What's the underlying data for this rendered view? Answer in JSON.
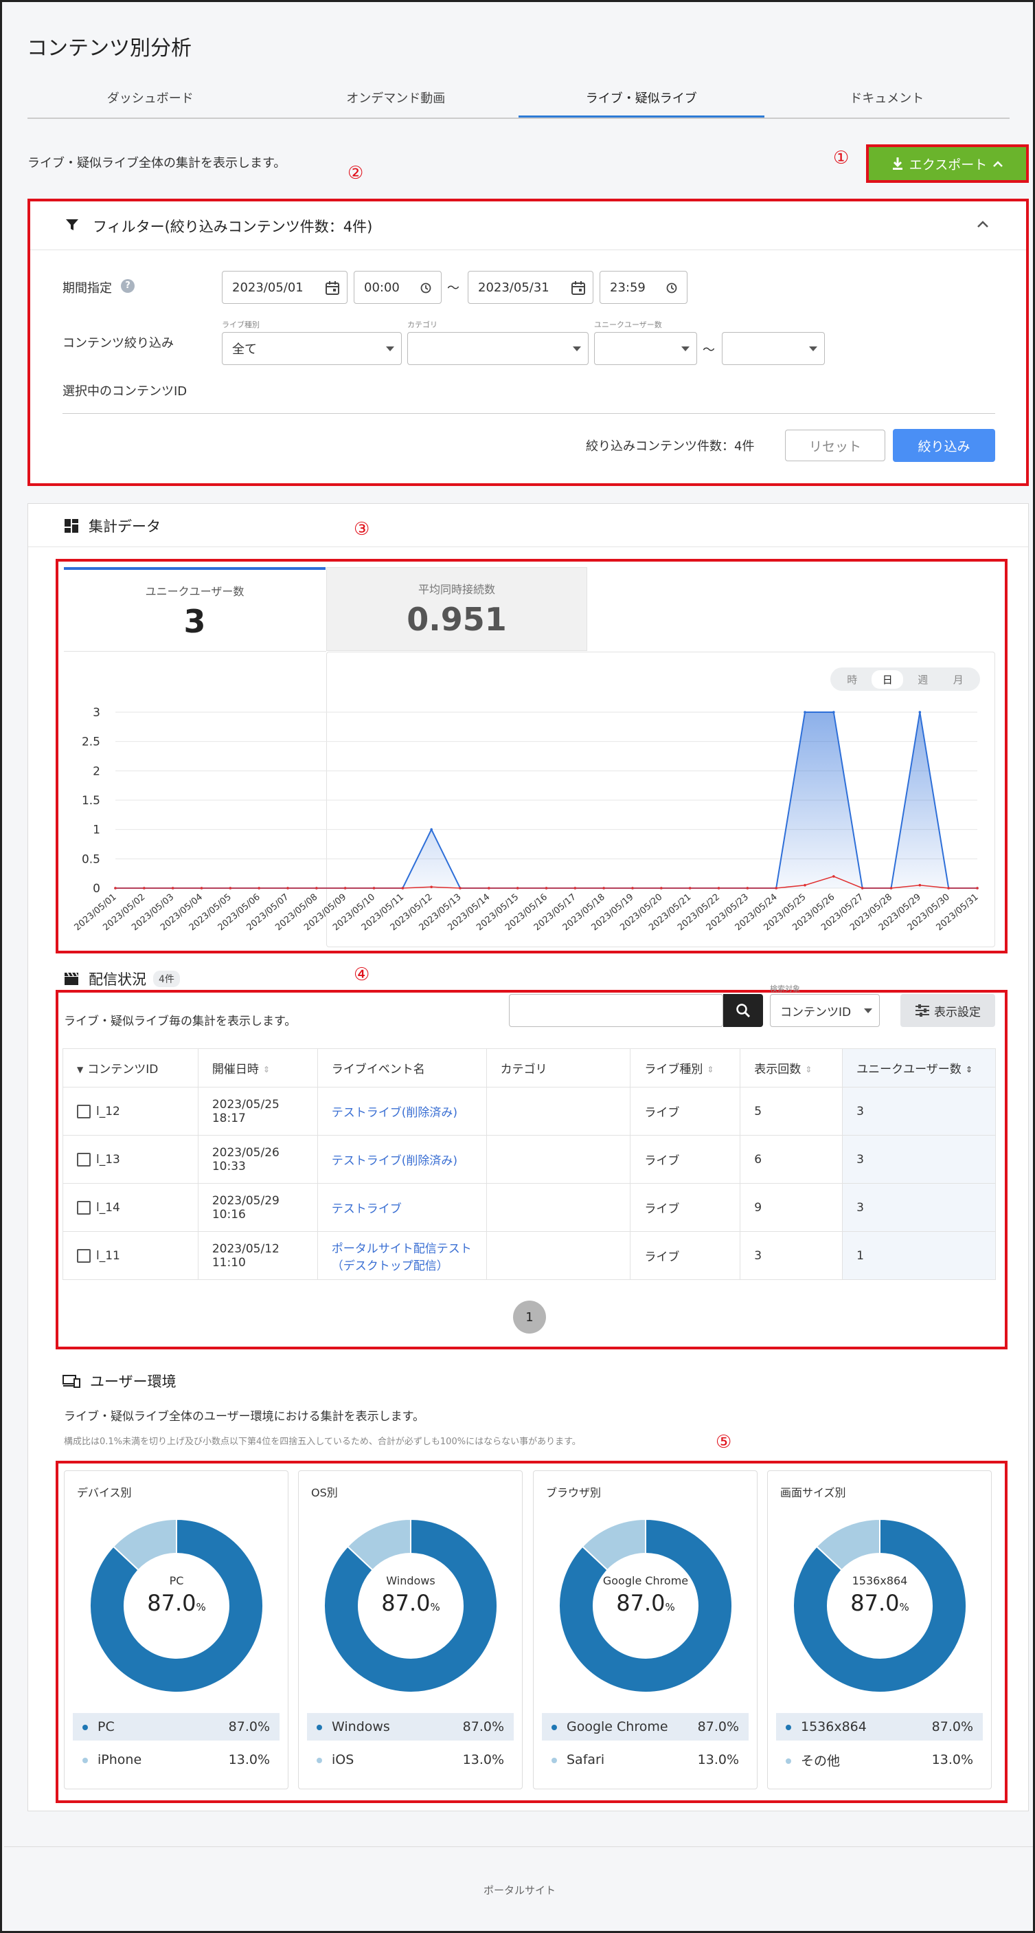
{
  "page": {
    "title": "コンテンツ別分析",
    "description": "ライブ・疑似ライブ全体の集計を表示します。"
  },
  "tabs": [
    {
      "label": "ダッシュボード",
      "active": false
    },
    {
      "label": "オンデマンド動画",
      "active": false
    },
    {
      "label": "ライブ・疑似ライブ",
      "active": true
    },
    {
      "label": "ドキュメント",
      "active": false
    }
  ],
  "annotations": [
    "①",
    "②",
    "③",
    "④",
    "⑤"
  ],
  "export": {
    "label": "エクスポート",
    "color": "#6ab42c"
  },
  "filter": {
    "title": "フィルター(絞り込みコンテンツ件数：4件)",
    "period_label": "期間指定",
    "start_date": "2023/05/01",
    "start_time": "00:00",
    "end_date": "2023/05/31",
    "end_time": "23:59",
    "range_sep": "～",
    "content_filter_label": "コンテンツ絞り込み",
    "live_type_caption": "ライブ種別",
    "live_type_value": "全て",
    "category_caption": "カテゴリ",
    "category_value": "",
    "unique_caption": "ユニークユーザー数",
    "selected_ids_label": "選択中のコンテンツID",
    "count_text": "絞り込みコンテンツ件数：4件",
    "reset_label": "リセット",
    "apply_label": "絞り込み",
    "apply_color": "#4a8ff5"
  },
  "summary": {
    "title": "集計データ",
    "kpis": [
      {
        "label": "ユニークユーザー数",
        "value": "3",
        "active": true
      },
      {
        "label": "平均同時接続数",
        "value": "0.951",
        "active": false
      }
    ],
    "granularity": [
      {
        "label": "時",
        "active": false
      },
      {
        "label": "日",
        "active": true
      },
      {
        "label": "週",
        "active": false
      },
      {
        "label": "月",
        "active": false
      }
    ]
  },
  "chart_data": {
    "type": "area",
    "x": [
      "2023/05/01",
      "2023/05/02",
      "2023/05/03",
      "2023/05/04",
      "2023/05/05",
      "2023/05/06",
      "2023/05/07",
      "2023/05/08",
      "2023/05/09",
      "2023/05/10",
      "2023/05/11",
      "2023/05/12",
      "2023/05/13",
      "2023/05/14",
      "2023/05/15",
      "2023/05/16",
      "2023/05/17",
      "2023/05/18",
      "2023/05/19",
      "2023/05/20",
      "2023/05/21",
      "2023/05/22",
      "2023/05/23",
      "2023/05/24",
      "2023/05/25",
      "2023/05/26",
      "2023/05/27",
      "2023/05/28",
      "2023/05/29",
      "2023/05/30",
      "2023/05/31"
    ],
    "series": [
      {
        "values": [
          0,
          0,
          0,
          0,
          0,
          0,
          0,
          0,
          0,
          0,
          0,
          1,
          0,
          0,
          0,
          0,
          0,
          0,
          0,
          0,
          0,
          0,
          0,
          0,
          3,
          3,
          0,
          0,
          3,
          0,
          0
        ],
        "color": "#2e6fd8"
      },
      {
        "values": [
          0,
          0,
          0,
          0,
          0,
          0,
          0,
          0,
          0,
          0,
          0,
          0.02,
          0,
          0,
          0,
          0,
          0,
          0,
          0,
          0,
          0,
          0,
          0,
          0,
          0.05,
          0.2,
          0,
          0,
          0.05,
          0,
          0
        ],
        "color": "#e03030"
      }
    ],
    "yticks": [
      "0",
      "0.5",
      "1",
      "1.5",
      "2",
      "2.5",
      "3"
    ],
    "ylim": [
      0,
      3
    ],
    "grid": true
  },
  "delivery": {
    "title": "配信状況",
    "count_badge": "4件",
    "description": "ライブ・疑似ライブ毎の集計を表示します。",
    "search_caption": "検索対象",
    "search_target": "コンテンツID",
    "search_placeholder": "",
    "display_settings_label": "表示設定",
    "columns": [
      "コンテンツID",
      "開催日時",
      "ライブイベント名",
      "カテゴリ",
      "ライブ種別",
      "表示回数",
      "ユニークユーザー数"
    ],
    "rows": [
      {
        "id": "l_12",
        "date": "2023/05/25",
        "time": "18:17",
        "name": "テストライブ(削除済み)",
        "category": "",
        "type": "ライブ",
        "views": "5",
        "users": "3"
      },
      {
        "id": "l_13",
        "date": "2023/05/26",
        "time": "10:33",
        "name": "テストライブ(削除済み)",
        "category": "",
        "type": "ライブ",
        "views": "6",
        "users": "3"
      },
      {
        "id": "l_14",
        "date": "2023/05/29",
        "time": "10:16",
        "name": "テストライブ",
        "category": "",
        "type": "ライブ",
        "views": "9",
        "users": "3"
      },
      {
        "id": "l_11",
        "date": "2023/05/12",
        "time": "11:10",
        "name": "ポータルサイト配信テスト（デスクトップ配信）",
        "category": "",
        "type": "ライブ",
        "views": "3",
        "users": "1"
      }
    ],
    "page": "1"
  },
  "environment": {
    "title": "ユーザー環境",
    "description": "ライブ・疑似ライブ全体のユーザー環境における集計を表示します。",
    "note": "構成比は0.1%未満を切り上げ及び小数点以下第4位を四捨五入しているため、合計が必ずしも100%にはならない事があります。",
    "colors": {
      "primary": "#1f77b4",
      "secondary": "#a9cde3"
    },
    "cards": [
      {
        "title": "デバイス別",
        "center_label": "PC",
        "center_value": "87.0",
        "unit": "%",
        "items": [
          {
            "name": "PC",
            "value": "87.0%",
            "share": 87.0
          },
          {
            "name": "iPhone",
            "value": "13.0%",
            "share": 13.0
          }
        ]
      },
      {
        "title": "OS別",
        "center_label": "Windows",
        "center_value": "87.0",
        "unit": "%",
        "items": [
          {
            "name": "Windows",
            "value": "87.0%",
            "share": 87.0
          },
          {
            "name": "iOS",
            "value": "13.0%",
            "share": 13.0
          }
        ]
      },
      {
        "title": "ブラウザ別",
        "center_label": "Google Chrome",
        "center_value": "87.0",
        "unit": "%",
        "items": [
          {
            "name": "Google Chrome",
            "value": "87.0%",
            "share": 87.0
          },
          {
            "name": "Safari",
            "value": "13.0%",
            "share": 13.0
          }
        ]
      },
      {
        "title": "画面サイズ別",
        "center_label": "1536x864",
        "center_value": "87.0",
        "unit": "%",
        "items": [
          {
            "name": "1536x864",
            "value": "87.0%",
            "share": 87.0
          },
          {
            "name": "その他",
            "value": "13.0%",
            "share": 13.0
          }
        ]
      }
    ]
  },
  "footer": {
    "label": "ポータルサイト"
  }
}
